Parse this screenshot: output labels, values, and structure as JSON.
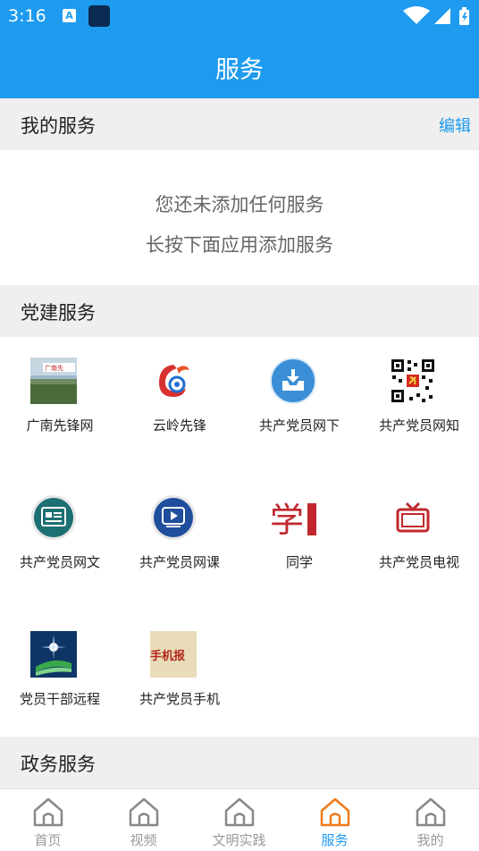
{
  "status": {
    "time": "3:16",
    "notification_badge": "A",
    "icons": [
      "notification-a-icon",
      "app-square-icon",
      "wifi-icon",
      "signal-icon",
      "battery-icon"
    ]
  },
  "header": {
    "title": "服务"
  },
  "my_services": {
    "title": "我的服务",
    "edit_label": "编辑",
    "empty_line1": "您还未添加任何服务",
    "empty_line2": "长按下面应用添加服务"
  },
  "party_services": {
    "title": "党建服务",
    "items": [
      {
        "label": "广南先锋网",
        "icon": "guangnan-photo-icon"
      },
      {
        "label": "云岭先锋",
        "icon": "yunling-logo-icon"
      },
      {
        "label": "共产党员网下",
        "icon": "download-tray-icon"
      },
      {
        "label": "共产党员网知",
        "icon": "qr-code-icon"
      },
      {
        "label": "共产党员网文",
        "icon": "document-circle-icon"
      },
      {
        "label": "共产党员网课",
        "icon": "video-circle-icon"
      },
      {
        "label": "同学",
        "icon": "xue-character-icon"
      },
      {
        "label": "共产党员电视",
        "icon": "tv-icon"
      },
      {
        "label": "党员干部远程",
        "icon": "remote-education-icon"
      },
      {
        "label": "共产党员手机",
        "icon": "phone-newspaper-icon"
      }
    ]
  },
  "government_services": {
    "title": "政务服务"
  },
  "tabbar": {
    "items": [
      {
        "label": "首页",
        "active": false
      },
      {
        "label": "视频",
        "active": false
      },
      {
        "label": "文明实践",
        "active": false
      },
      {
        "label": "服务",
        "active": true
      },
      {
        "label": "我的",
        "active": false
      }
    ]
  },
  "colors": {
    "accent": "#1E9BEF",
    "section_bg": "#EFEFEF",
    "tab_inactive": "#999999",
    "party_red": "#C8102E"
  }
}
